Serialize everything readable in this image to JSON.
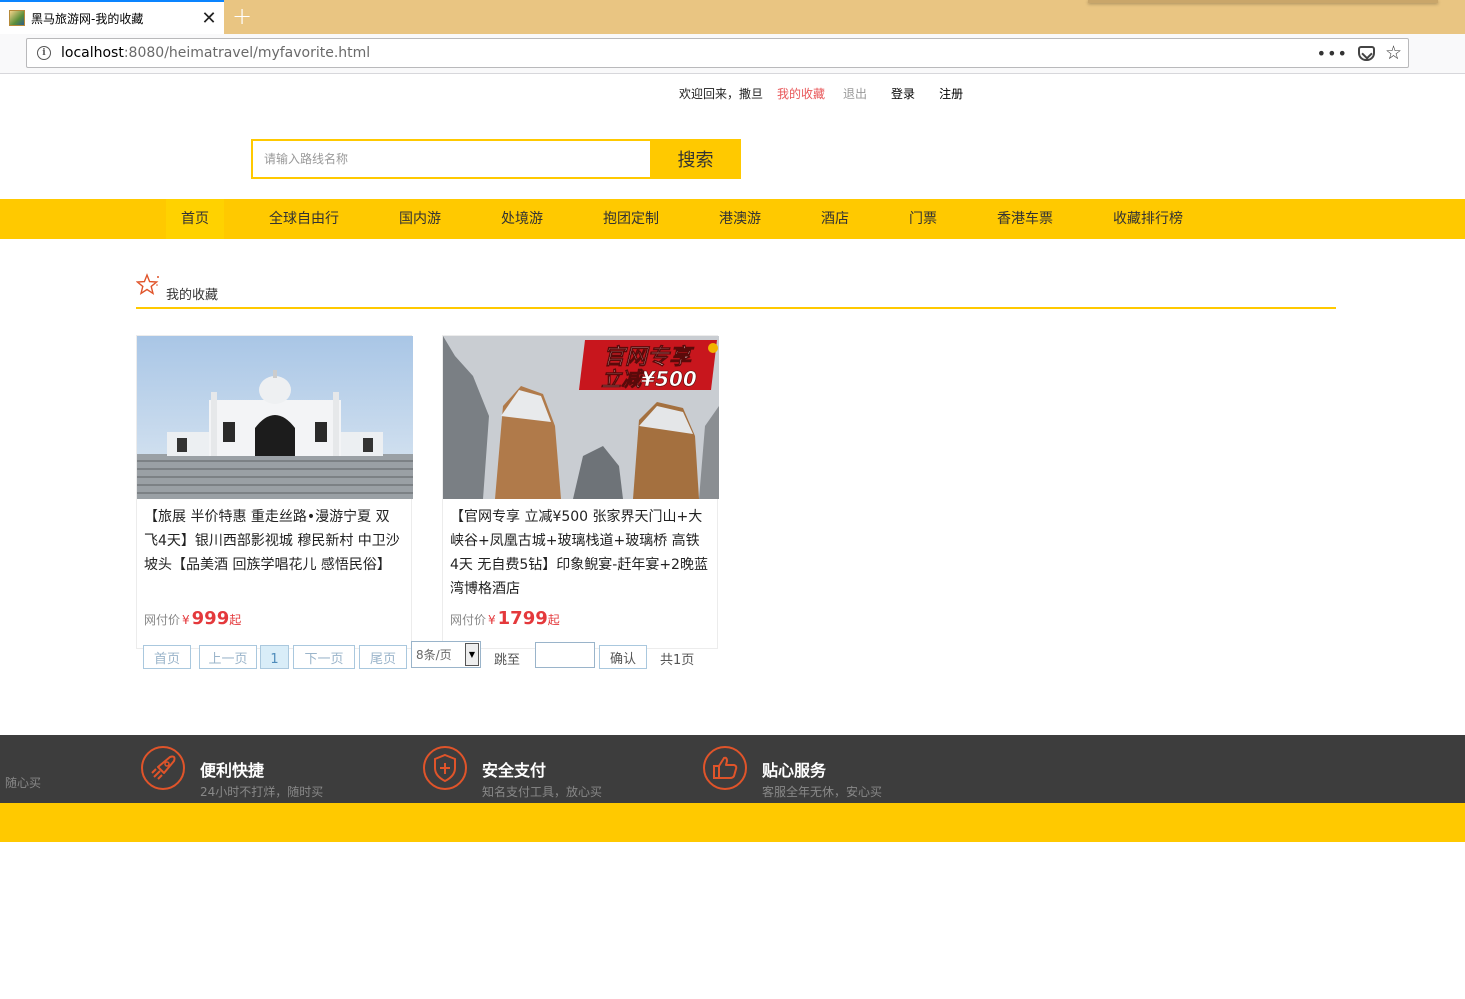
{
  "browser": {
    "tab_title": "黑马旅游网-我的收藏",
    "tab_close": "✕",
    "new_tab": "+",
    "url_host": "localhost",
    "url_path": ":8080/heimatravel/myfavorite.html",
    "info_icon": "i",
    "menu_dots": "•••",
    "bookmark_star": "☆"
  },
  "topbar": {
    "welcome": "欢迎回来，撒旦",
    "my_favorite": "我的收藏",
    "logout": "退出",
    "login": "登录",
    "register": "注册"
  },
  "search": {
    "placeholder": "请输入路线名称",
    "button": "搜索"
  },
  "nav": {
    "items": [
      "首页",
      "全球自由行",
      "国内游",
      "处境游",
      "抱团定制",
      "港澳游",
      "酒店",
      "门票",
      "香港车票",
      "收藏排行榜"
    ],
    "active": "首页"
  },
  "favorites": {
    "title": "我的收藏",
    "items": [
      {
        "desc": "【旅展 半价特惠 重走丝路•漫游宁夏 双飞4天】银川西部影视城 穆民新村 中卫沙坡头【品美酒 回族学唱花儿 感悟民俗】",
        "price_label": "网付价",
        "currency": "¥",
        "price": "999",
        "suffix": "起"
      },
      {
        "desc": "【官网专享 立减¥500 张家界天门山+大峡谷+凤凰古城+玻璃栈道+玻璃桥 高铁4天 无自费5钻】印象鲵宴-赶年宴+2晚蓝湾博格酒店",
        "price_label": "网付价",
        "currency": "¥",
        "price": "1799",
        "suffix": "起",
        "badge_line1": "官网专享",
        "badge_line2": "立减¥500"
      }
    ]
  },
  "pager": {
    "first": "首页",
    "prev": "上一页",
    "current": "1",
    "next": "下一页",
    "last": "尾页",
    "page_size": "8条/页",
    "jump_label": "跳至",
    "confirm": "确认",
    "total": "共1页"
  },
  "footer": {
    "edge_text": "随心买",
    "features": [
      {
        "title": "便利快捷",
        "sub": "24小时不打烊，随时买",
        "icon": "rocket-icon"
      },
      {
        "title": "安全支付",
        "sub": "知名支付工具，放心买",
        "icon": "shield-icon"
      },
      {
        "title": "贴心服务",
        "sub": "客服全年无休，安心买",
        "icon": "thumbs-up-icon"
      }
    ]
  },
  "colors": {
    "brand_yellow": "#ffc900",
    "price_red": "#e4393c",
    "footer_dark": "#3d3d3d",
    "icon_orange": "#e0542a"
  }
}
